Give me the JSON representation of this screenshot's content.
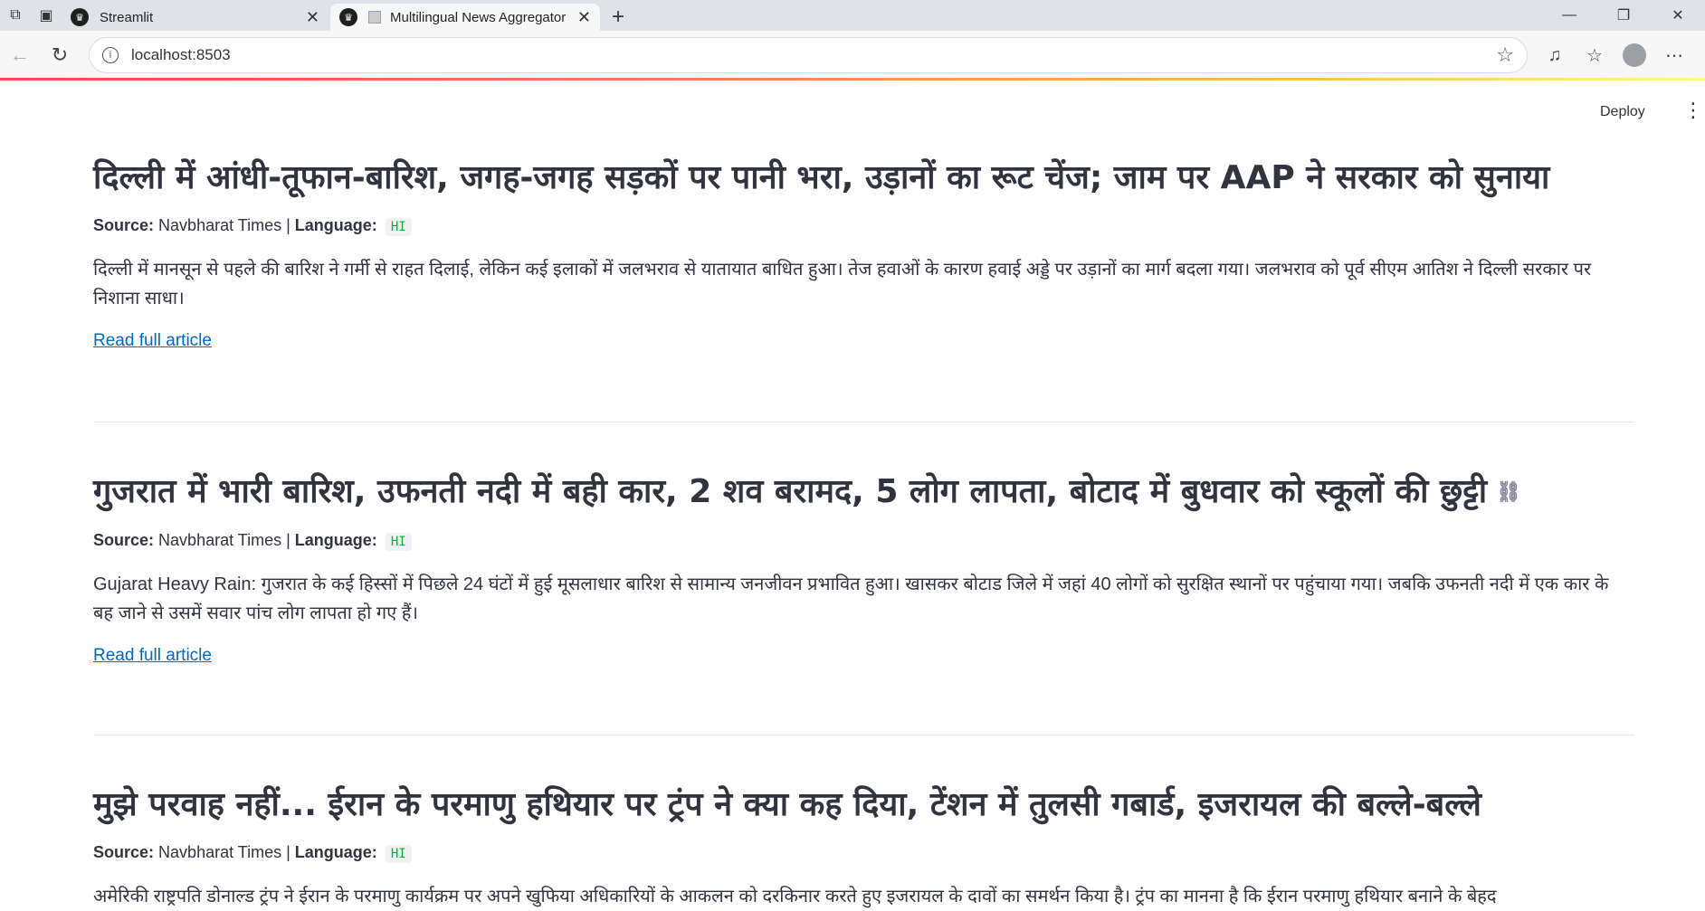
{
  "browser": {
    "tabs": [
      {
        "title": "Streamlit",
        "active": false
      },
      {
        "title": "Multilingual News Aggregator",
        "active": true
      }
    ],
    "url": "localhost:8503"
  },
  "app": {
    "deploy_label": "Deploy",
    "articles": [
      {
        "title": "दिल्ली में आंधी-तूफान-बारिश, जगह-जगह सड़कों पर पानी भरा, उड़ानों का रूट चेंज; जाम पर AAP ने सरकार को सुनाया",
        "source_label": "Source:",
        "source": "Navbharat Times",
        "language_label": "Language:",
        "language": "HI",
        "summary": "दिल्ली में मानसून से पहले की बारिश ने गर्मी से राहत दिलाई, लेकिन कई इलाकों में जलभराव से यातायात बाधित हुआ। तेज हवाओं के कारण हवाई अड्डे पर उड़ानों का मार्ग बदला गया। जलभराव को पूर्व सीएम आतिश ने दिल्ली सरकार पर निशाना साधा।",
        "link": "Read full article"
      },
      {
        "title": "गुजरात में भारी बारिश, उफनती नदी में बही कार, 2 शव बरामद, 5 लोग लापता, बोटाद में बुधवार को स्कूलों की छुट्टी",
        "source_label": "Source:",
        "source": "Navbharat Times",
        "language_label": "Language:",
        "language": "HI",
        "summary": "Gujarat Heavy Rain: गुजरात के कई हिस्सों में पिछले 24 घंटों में हुई मूसलाधार बारिश से सामान्य जनजीवन प्रभावित हुआ। खासकर बोटाड जिले में जहां 40 लोगों को सुरक्षित स्थानों पर पहुंचाया गया। जबकि उफनती नदी में एक कार के बह जाने से उसमें सवार पांच लोग लापता हो गए हैं।",
        "link": "Read full article"
      },
      {
        "title": "मुझे परवाह नहीं... ईरान के परमाणु हथियार पर ट्रंप ने क्या कह दिया, टेंशन में तुलसी गबार्ड, इजरायल की बल्ले-बल्ले",
        "source_label": "Source:",
        "source": "Navbharat Times",
        "language_label": "Language:",
        "language": "HI",
        "summary": "अमेरिकी राष्ट्रपति डोनाल्ड ट्रंप ने ईरान के परमाणु कार्यक्रम पर अपने खुफिया अधिकारियों के आकलन को दरकिनार करते हुए इजरायल के दावों का समर्थन किया है। ट्रंप का मानना है कि ईरान परमाणु हथियार बनाने के बेहद"
      }
    ]
  }
}
